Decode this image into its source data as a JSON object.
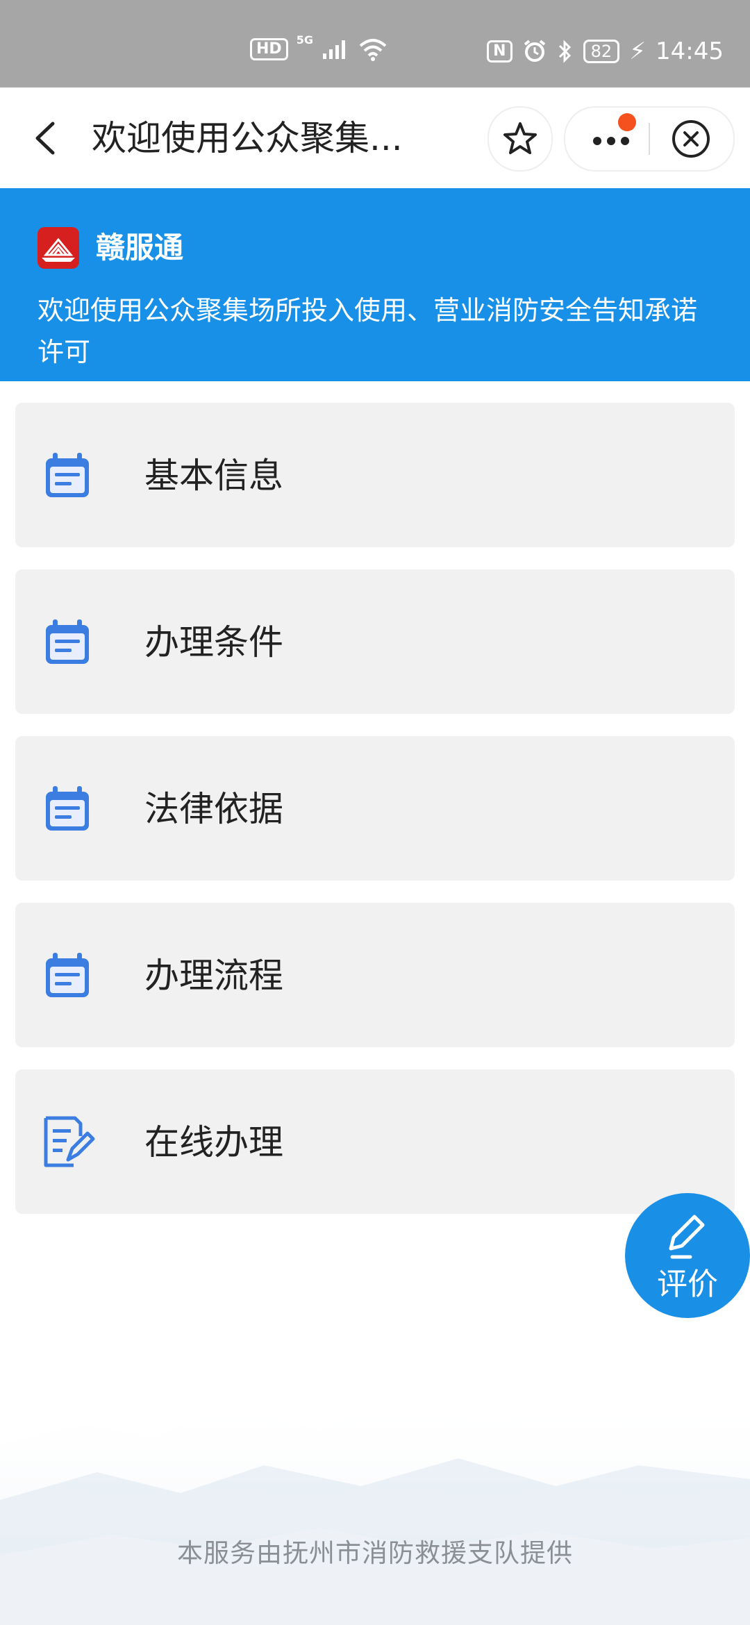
{
  "status_bar": {
    "hd_label": "HD",
    "network_label": "5G",
    "nfc_label": "N",
    "battery": "82",
    "time": "14:45"
  },
  "nav": {
    "title": "欢迎使用公众聚集..."
  },
  "banner": {
    "brand_name": "赣服通",
    "description": "欢迎使用公众聚集场所投入使用、营业消防安全告知承诺许可"
  },
  "menu": [
    {
      "label": "基本信息",
      "icon": "calendar-doc-icon"
    },
    {
      "label": "办理条件",
      "icon": "calendar-doc-icon"
    },
    {
      "label": "法律依据",
      "icon": "calendar-doc-icon"
    },
    {
      "label": "办理流程",
      "icon": "calendar-doc-icon"
    },
    {
      "label": "在线办理",
      "icon": "edit-document-icon"
    }
  ],
  "fab": {
    "label": "评价",
    "icon": "pencil-icon"
  },
  "footer": {
    "text": "本服务由抚州市消防救援支队提供"
  },
  "colors": {
    "banner": "#1890e8",
    "icon_blue": "#3b7de0",
    "card_bg": "#f1f1f1",
    "status_bar": "#a6a6a6",
    "notify_dot": "#f4511e",
    "brand_red": "#d61f1f"
  }
}
